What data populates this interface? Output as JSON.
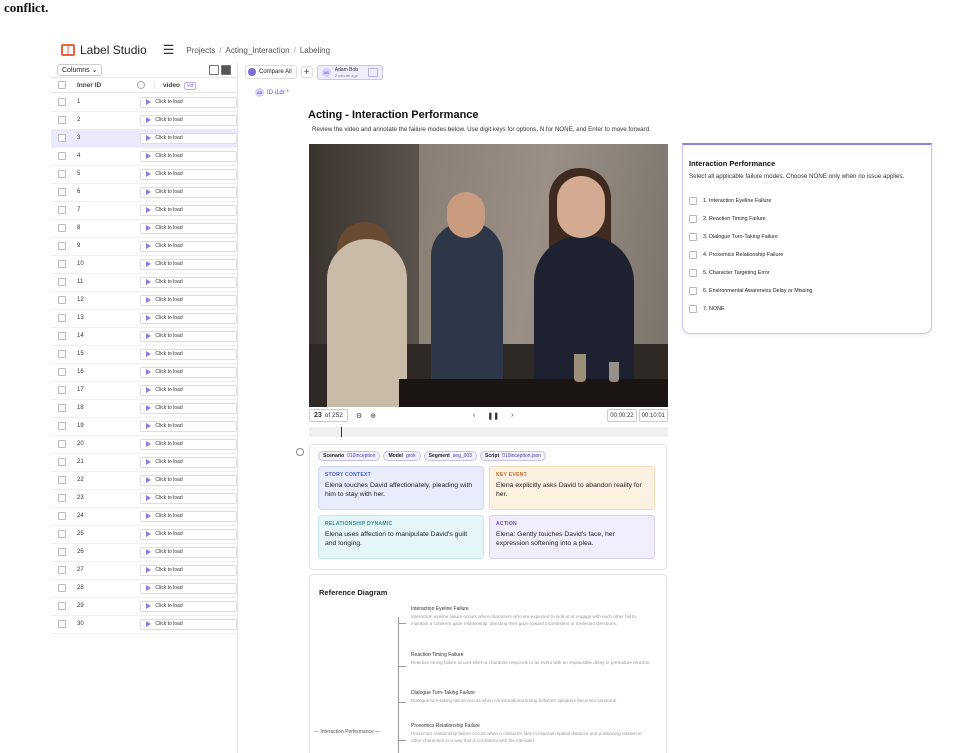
{
  "caption": "conflict.",
  "topbar": {
    "app_name": "Label Studio",
    "breadcrumb": [
      "Projects",
      "Acting_Interaction",
      "Labeling"
    ]
  },
  "sidebar": {
    "columns_label": "Columns",
    "header": {
      "inner_id": "Inner ID",
      "video": "video",
      "video_tag": "vid"
    },
    "cell_text": "Click to load",
    "selected_row": "3",
    "rows": [
      "1",
      "2",
      "3",
      "4",
      "5",
      "6",
      "7",
      "8",
      "9",
      "10",
      "11",
      "12",
      "13",
      "14",
      "15",
      "16",
      "17",
      "18",
      "19",
      "20",
      "21",
      "22",
      "23",
      "24",
      "25",
      "26",
      "27",
      "28",
      "29",
      "30"
    ]
  },
  "annotation_bar": {
    "compare_all": "Compare All",
    "annotator_initials": "AB",
    "annotator_name": "Adam Bob",
    "annotator_time": "2 minute ago",
    "id_initials": "AB",
    "id_text": "ID i1dr *"
  },
  "task": {
    "title": "Acting - Interaction Performance",
    "instructions": "Review the video and annotate the failure modes below. Use digit keys for options, N for NONE, and Enter to move forward."
  },
  "player": {
    "frame_current": "23",
    "frame_of": "of 252",
    "time_current": "00:00:22",
    "time_total": "00:10:01",
    "progress": 0.09
  },
  "info": {
    "chips": [
      {
        "key": "Scenario",
        "value": "010inception"
      },
      {
        "key": "Model",
        "value": "grok"
      },
      {
        "key": "Segment",
        "value": "seg_003"
      },
      {
        "key": "Script",
        "value": "010inception.json"
      }
    ],
    "story_context": {
      "label": "STORY CONTEXT",
      "text": "Elena touches David affectionately, pleading with him to stay with her."
    },
    "key_event": {
      "label": "KEY EVENT",
      "text": "Elena explicitly asks David to abandon reality for her."
    },
    "relationship_dynamic": {
      "label": "RELATIONSHIP DYNAMIC",
      "text": "Elena uses affection to manipulate David's guilt and longing."
    },
    "action": {
      "label": "ACTION",
      "text": "Elena: Gently touches David's face, her expression softening into a plea."
    }
  },
  "reference": {
    "title": "Reference Diagram",
    "root": "Interaction Performance",
    "items": [
      {
        "name": "Interaction Eyeline Failure",
        "desc": "Interaction eyeline failure occurs when characters who are expected to look at or engage with each other fail to maintain a coherent gaze relationship, directing their gaze toward inconsistent or irrelevant directions."
      },
      {
        "name": "Reaction Timing Failure",
        "desc": "Reaction timing failure occurs when a character responds to an event with an implausible delay or premature reaction."
      },
      {
        "name": "Dialogue Turn-Taking Failure",
        "desc": "Dialogue turn-taking failure occurs when conversational timing between speakers becomes unnatural."
      },
      {
        "name": "Proxemics Relationship Failure",
        "desc": "Proxemics relationship failure occurs when a character fails to maintain spatial distance and positioning relative to other characters in a way that is consistent with the intended"
      }
    ]
  },
  "panel": {
    "title": "Interaction Performance",
    "instruction": "Select all applicable failure modes. Choose NONE only when no issue applies.",
    "options": [
      "1. Interaction Eyeline Failure",
      "2. Reaction Timing Failure",
      "3. Dialogue Turn-Taking Failure",
      "4. Proxemics Relationship Failure",
      "5. Character Targeting Error",
      "6. Environmental Awareness Delay or Missing",
      "7. NONE"
    ]
  }
}
